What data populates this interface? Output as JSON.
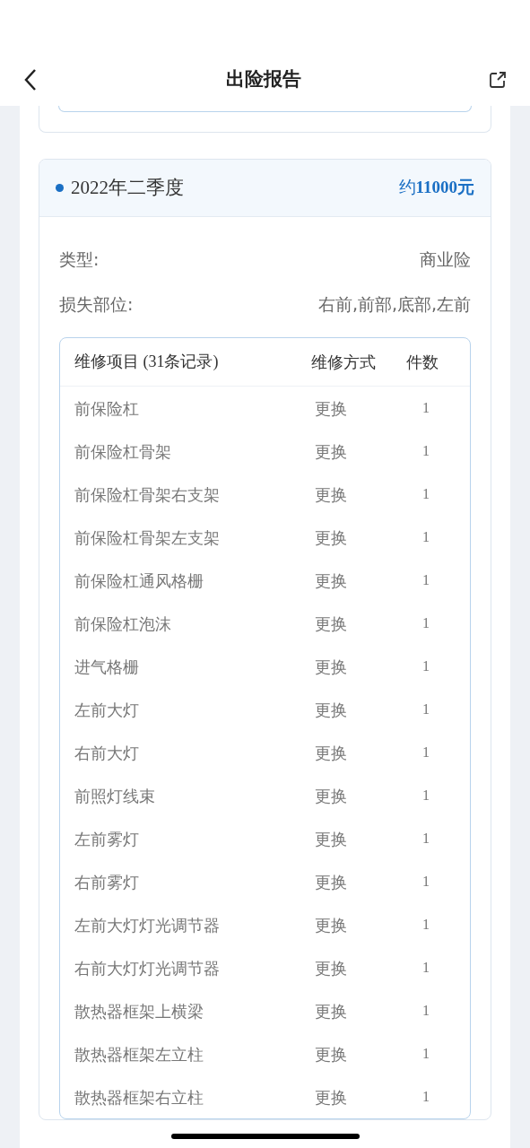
{
  "nav": {
    "title": "出险报告"
  },
  "record": {
    "period": "2022年二季度",
    "amount_prefix": "约",
    "amount": "11000元",
    "fields": [
      {
        "label": "类型:",
        "value": "商业险"
      },
      {
        "label": "损失部位:",
        "value": "右前,前部,底部,左前"
      }
    ],
    "table": {
      "columns": [
        "维修项目 (31条记录)",
        "维修方式",
        "件数"
      ],
      "rows": [
        [
          "前保险杠",
          "更换",
          "1"
        ],
        [
          "前保险杠骨架",
          "更换",
          "1"
        ],
        [
          "前保险杠骨架右支架",
          "更换",
          "1"
        ],
        [
          "前保险杠骨架左支架",
          "更换",
          "1"
        ],
        [
          "前保险杠通风格栅",
          "更换",
          "1"
        ],
        [
          "前保险杠泡沫",
          "更换",
          "1"
        ],
        [
          "进气格栅",
          "更换",
          "1"
        ],
        [
          "左前大灯",
          "更换",
          "1"
        ],
        [
          "右前大灯",
          "更换",
          "1"
        ],
        [
          "前照灯线束",
          "更换",
          "1"
        ],
        [
          "左前雾灯",
          "更换",
          "1"
        ],
        [
          "右前雾灯",
          "更换",
          "1"
        ],
        [
          "左前大灯灯光调节器",
          "更换",
          "1"
        ],
        [
          "右前大灯灯光调节器",
          "更换",
          "1"
        ],
        [
          "散热器框架上横梁",
          "更换",
          "1"
        ],
        [
          "散热器框架左立柱",
          "更换",
          "1"
        ],
        [
          "散热器框架右立柱",
          "更换",
          "1"
        ]
      ]
    }
  }
}
